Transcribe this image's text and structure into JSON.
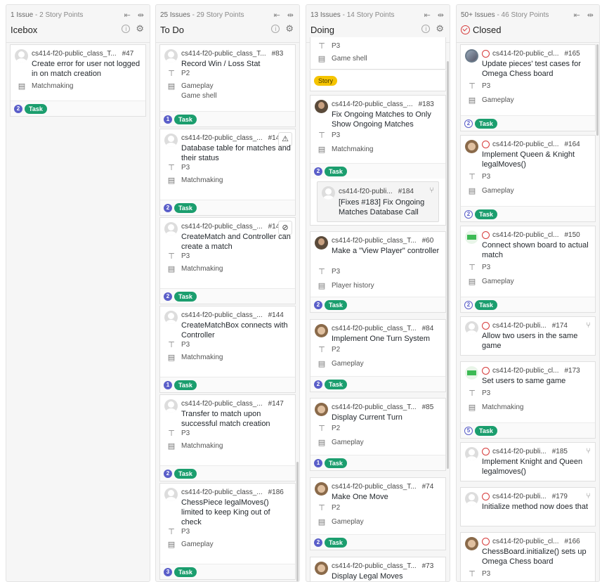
{
  "columns": [
    {
      "meta": "1 Issue",
      "points": "2 Story Points",
      "title": "Icebox"
    },
    {
      "meta": "25 Issues",
      "points": "29 Story Points",
      "title": "To Do"
    },
    {
      "meta": "13 Issues",
      "points": "14 Story Points",
      "title": "Doing"
    },
    {
      "meta": "50+ Issues",
      "points": "46 Story Points",
      "title": "Closed"
    }
  ],
  "icebox": [
    {
      "repo": "cs414-f20-public_class_T...",
      "num": "#47",
      "title": "Create error for user not logged in on match creation",
      "field1": "Matchmaking",
      "est": "2",
      "tag": "Task"
    }
  ],
  "todo": [
    {
      "repo": "cs414-f20-public_class_T...",
      "num": "#83",
      "title": "Record Win / Loss Stat",
      "priority": "P2",
      "field1": "Gameplay",
      "field2": "Game shell",
      "est": "1",
      "tag": "Task"
    },
    {
      "repo": "cs414-f20-public_class_...",
      "num": "#142",
      "title": "Database table for matches and their status",
      "priority": "P3",
      "field1": "Matchmaking",
      "est": "2",
      "tag": "Task"
    },
    {
      "repo": "cs414-f20-public_class_...",
      "num": "#143",
      "title": "CreateMatch and Controller can create a match",
      "priority": "P3",
      "field1": "Matchmaking",
      "est": "2",
      "tag": "Task"
    },
    {
      "repo": "cs414-f20-public_class_...",
      "num": "#144",
      "title": "CreateMatchBox connects with Controller",
      "priority": "P3",
      "field1": "Matchmaking",
      "est": "1",
      "tag": "Task"
    },
    {
      "repo": "cs414-f20-public_class_...",
      "num": "#147",
      "title": "Transfer to match upon successful match creation",
      "priority": "P3",
      "field1": "Matchmaking",
      "est": "2",
      "tag": "Task"
    },
    {
      "repo": "cs414-f20-public_class_...",
      "num": "#186",
      "title": "ChessPiece legalMoves() limited to keep King out of check",
      "priority": "P3",
      "field1": "Gameplay",
      "est": "3",
      "tag": "Task"
    }
  ],
  "doing": {
    "partial": {
      "priority": "P3",
      "field1": "Game shell",
      "label": "Story"
    },
    "cards": [
      {
        "repo": "cs414-f20-public_class_...",
        "num": "#183",
        "title": "Fix Ongoing Matches to Only Show Ongoing Matches",
        "priority": "P3",
        "field1": "Matchmaking",
        "est": "2",
        "tag": "Task"
      },
      {
        "repo": "cs414-f20-public_class_T...",
        "num": "#60",
        "title": "Make a \"View Player\" controller",
        "priority": "P3",
        "field1": "Player history",
        "est": "2",
        "tag": "Task"
      },
      {
        "repo": "cs414-f20-public_class_T...",
        "num": "#84",
        "title": "Implement One Turn System",
        "priority": "P2",
        "field1": "Gameplay",
        "est": "2",
        "tag": "Task"
      },
      {
        "repo": "cs414-f20-public_class_T...",
        "num": "#85",
        "title": "Display Current Turn",
        "priority": "P2",
        "field1": "Gameplay",
        "est": "1",
        "tag": "Task"
      },
      {
        "repo": "cs414-f20-public_class_T...",
        "num": "#74",
        "title": "Make One Move",
        "priority": "P2",
        "field1": "Gameplay",
        "est": "2",
        "tag": "Task"
      },
      {
        "repo": "cs414-f20-public_class_T...",
        "num": "#73",
        "title": "Display Legal Moves"
      }
    ],
    "epic": {
      "repo": "cs414-f20-publi...",
      "num": "#184",
      "title": "[Fixes #183] Fix Ongoing Matches Database Call"
    }
  },
  "closed": [
    {
      "repo": "cs414-f20-public_cl...",
      "num": "#165",
      "title": "Update pieces' test cases for Omega Chess board",
      "priority": "P3",
      "field1": "Gameplay",
      "est": "2",
      "tag": "Task"
    },
    {
      "repo": "cs414-f20-public_cl...",
      "num": "#164",
      "title": "Implement Queen & Knight legalMoves()",
      "priority": "P3",
      "field1": "Gameplay",
      "est": "2",
      "tag": "Task"
    },
    {
      "repo": "cs414-f20-public_cl...",
      "num": "#150",
      "title": "Connect shown board to actual match",
      "priority": "P3",
      "field1": "Gameplay",
      "est": "2",
      "tag": "Task"
    },
    {
      "repo": "cs414-f20-publi...",
      "num": "#174",
      "title": "Allow two users in the same game"
    },
    {
      "repo": "cs414-f20-public_cl...",
      "num": "#173",
      "title": "Set users to same game",
      "priority": "P3",
      "field1": "Matchmaking",
      "est": "5",
      "tag": "Task"
    },
    {
      "repo": "cs414-f20-publi...",
      "num": "#185",
      "title": "Implement Knight and Queen legalmoves()"
    },
    {
      "repo": "cs414-f20-publi...",
      "num": "#179",
      "title": "Initialize method now does that"
    },
    {
      "repo": "cs414-f20-public_cl...",
      "num": "#166",
      "title": "ChessBoard.initialize() sets up Omega Chess board",
      "priority": "P3"
    }
  ]
}
